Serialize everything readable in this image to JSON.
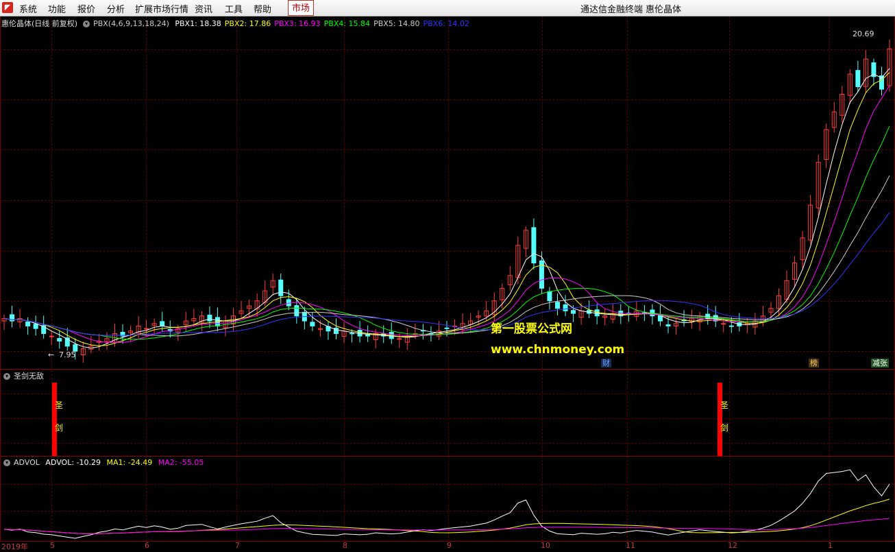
{
  "menubar": {
    "items": [
      "系统",
      "功能",
      "报价",
      "分析",
      "扩展市场行情",
      "资讯",
      "工具",
      "帮助"
    ],
    "active_item": "市场",
    "title": "通达信金融终端 惠伦晶体"
  },
  "main_panel": {
    "stock_title": "惠伦晶体(日线 前复权)",
    "indicator_header": "PBX(4,6,9,13,18,24)",
    "pbx": [
      {
        "label": "PBX1: 18.38",
        "color": "#ffffff"
      },
      {
        "label": "PBX2: 17.86",
        "color": "#ffff00"
      },
      {
        "label": "PBX3: 16.93",
        "color": "#ff00ff"
      },
      {
        "label": "PBX4: 15.84",
        "color": "#00ff00"
      },
      {
        "label": "PBX5: 14.80",
        "color": "#cccccc"
      },
      {
        "label": "PBX6: 14.02",
        "color": "#3333ff"
      }
    ],
    "high_label": "20.69",
    "low_label": "7.95",
    "event_tags": [
      {
        "text": "财",
        "color": "#66aaff",
        "bg": "#1a2a55"
      },
      {
        "text": "榜",
        "color": "#ffcc66",
        "bg": "#443311"
      },
      {
        "text": "减张",
        "color": "#ffffff",
        "bg": "#225522"
      }
    ]
  },
  "watermark": {
    "line1": "第一股票公式网",
    "line2": "www.chnmoney.com"
  },
  "sword_panel": {
    "title": "圣剑无敌",
    "signals": [
      {
        "chars": [
          "圣",
          "剑"
        ]
      },
      {
        "chars": [
          "圣",
          "剑"
        ]
      }
    ]
  },
  "advol_panel": {
    "title": "ADVOL",
    "advol_label": "ADVOL: -10.29",
    "ma1_label": "MA1: -24.49",
    "ma2_label": "MA2: -55.05",
    "colors": {
      "advol": "#ffffff",
      "ma1": "#ffff00",
      "ma2": "#ff00ff"
    }
  },
  "x_axis": {
    "labels": [
      "2019年",
      "5",
      "6",
      "7",
      "8",
      "9",
      "10",
      "11",
      "12",
      "1"
    ]
  },
  "chart_data": {
    "type": "candlestick",
    "price_range": [
      7.95,
      20.69
    ],
    "close": [
      9.3,
      9.2,
      9.3,
      9.0,
      8.9,
      8.7,
      8.6,
      8.4,
      8.2,
      8.0,
      8.1,
      8.2,
      8.4,
      8.5,
      8.7,
      8.6,
      8.8,
      9.0,
      8.9,
      9.1,
      9.0,
      8.8,
      8.9,
      9.2,
      9.3,
      9.4,
      9.2,
      9.0,
      9.2,
      9.4,
      9.6,
      9.8,
      10.0,
      10.4,
      10.8,
      10.2,
      9.8,
      9.4,
      9.2,
      9.0,
      8.9,
      8.8,
      8.7,
      8.8,
      8.7,
      8.6,
      8.6,
      8.7,
      8.6,
      8.5,
      8.5,
      8.6,
      8.7,
      8.8,
      8.7,
      8.8,
      8.9,
      9.0,
      9.1,
      9.2,
      9.4,
      9.6,
      10.0,
      10.5,
      11.0,
      12.2,
      12.8,
      11.5,
      10.5,
      10.0,
      9.7,
      9.6,
      9.5,
      9.6,
      9.5,
      9.4,
      9.4,
      9.5,
      9.4,
      9.5,
      9.6,
      9.5,
      9.4,
      9.2,
      9.0,
      9.1,
      9.2,
      9.3,
      9.4,
      9.3,
      9.2,
      9.1,
      9.0,
      9.0,
      9.1,
      9.2,
      9.4,
      9.7,
      10.2,
      10.8,
      11.5,
      12.5,
      13.8,
      15.5,
      16.8,
      17.5,
      18.2,
      19.0,
      18.5,
      19.6,
      18.9,
      18.4,
      20.0
    ],
    "legend": [
      "PBX1",
      "PBX2",
      "PBX3",
      "PBX4",
      "PBX5",
      "PBX6"
    ]
  }
}
